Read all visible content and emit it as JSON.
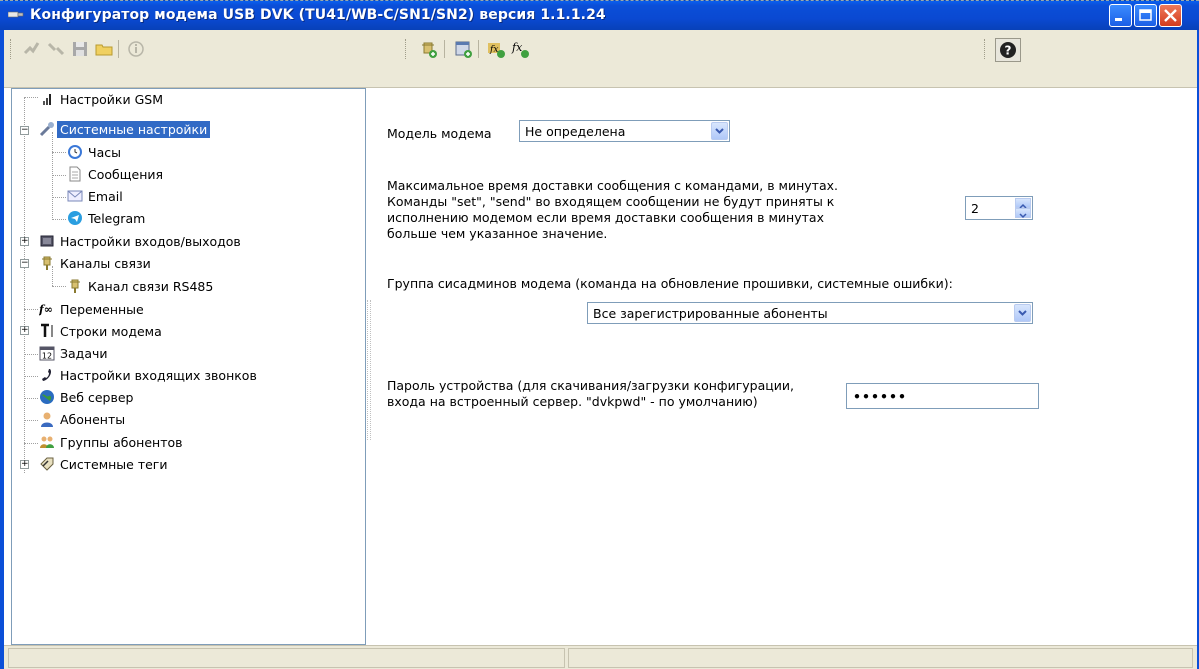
{
  "window": {
    "title": "Конфигуратор модема USB DVK (TU41/WB-C/SN1/SN2)  версия 1.1.1.24"
  },
  "icons": {
    "title": "modem-app-icon",
    "minimize": "minimize-icon",
    "maximize": "maximize-icon",
    "close": "close-icon",
    "help": "help-icon"
  },
  "colors": {
    "titlebar": "#0b4fd8",
    "selection": "#316ac5",
    "chrome": "#ece9d8"
  },
  "tree": {
    "items": [
      {
        "label": "Настройки GSM",
        "icon": "signal-bars-icon"
      },
      {
        "label": "Системные настройки",
        "icon": "wrench-icon",
        "selected": true,
        "expanded": true
      },
      {
        "label": "Часы",
        "icon": "clock-icon"
      },
      {
        "label": "Сообщения",
        "icon": "document-icon"
      },
      {
        "label": "Email",
        "icon": "envelope-icon"
      },
      {
        "label": "Telegram",
        "icon": "telegram-icon"
      },
      {
        "label": "Настройки входов/выходов",
        "icon": "io-board-icon",
        "collapsed": true
      },
      {
        "label": "Каналы связи",
        "icon": "channel-plug-icon",
        "expanded": true
      },
      {
        "label": "Канал связи RS485",
        "icon": "channel-plug-icon"
      },
      {
        "label": "Переменные",
        "icon": "function-icon"
      },
      {
        "label": "Строки модема",
        "icon": "text-cursor-icon",
        "collapsed": true
      },
      {
        "label": "Задачи",
        "icon": "calendar-icon"
      },
      {
        "label": "Настройки входящих звонков",
        "icon": "phone-icon"
      },
      {
        "label": "Веб сервер",
        "icon": "globe-icon"
      },
      {
        "label": "Абоненты",
        "icon": "user-icon"
      },
      {
        "label": "Группы абонентов",
        "icon": "users-group-icon"
      },
      {
        "label": "Системные теги",
        "icon": "tags-icon",
        "collapsed": true
      }
    ]
  },
  "settings": {
    "model_label": "Модель модема",
    "model_value": "Не определена",
    "delivery_text": [
      "Максимальное время доставки сообщения с командами, в минутах.",
      "Команды \"set\", \"send\" во входящем сообщении не будут приняты к",
      "исполнению модемом если время доставки сообщения в минутах",
      "больше чем указанное значение."
    ],
    "delivery_value": "2",
    "admins_label": "Группа сисадминов модема (команда на обновление прошивки, системные ошибки):",
    "admins_value": "Все зарегистрированные абоненты",
    "password_text": [
      "Пароль устройства (для скачивания/загрузки конфигурации,",
      "входа на встроенный сервер. \"dvkpwd\" - по умолчанию)"
    ],
    "password_value": "••••••"
  }
}
